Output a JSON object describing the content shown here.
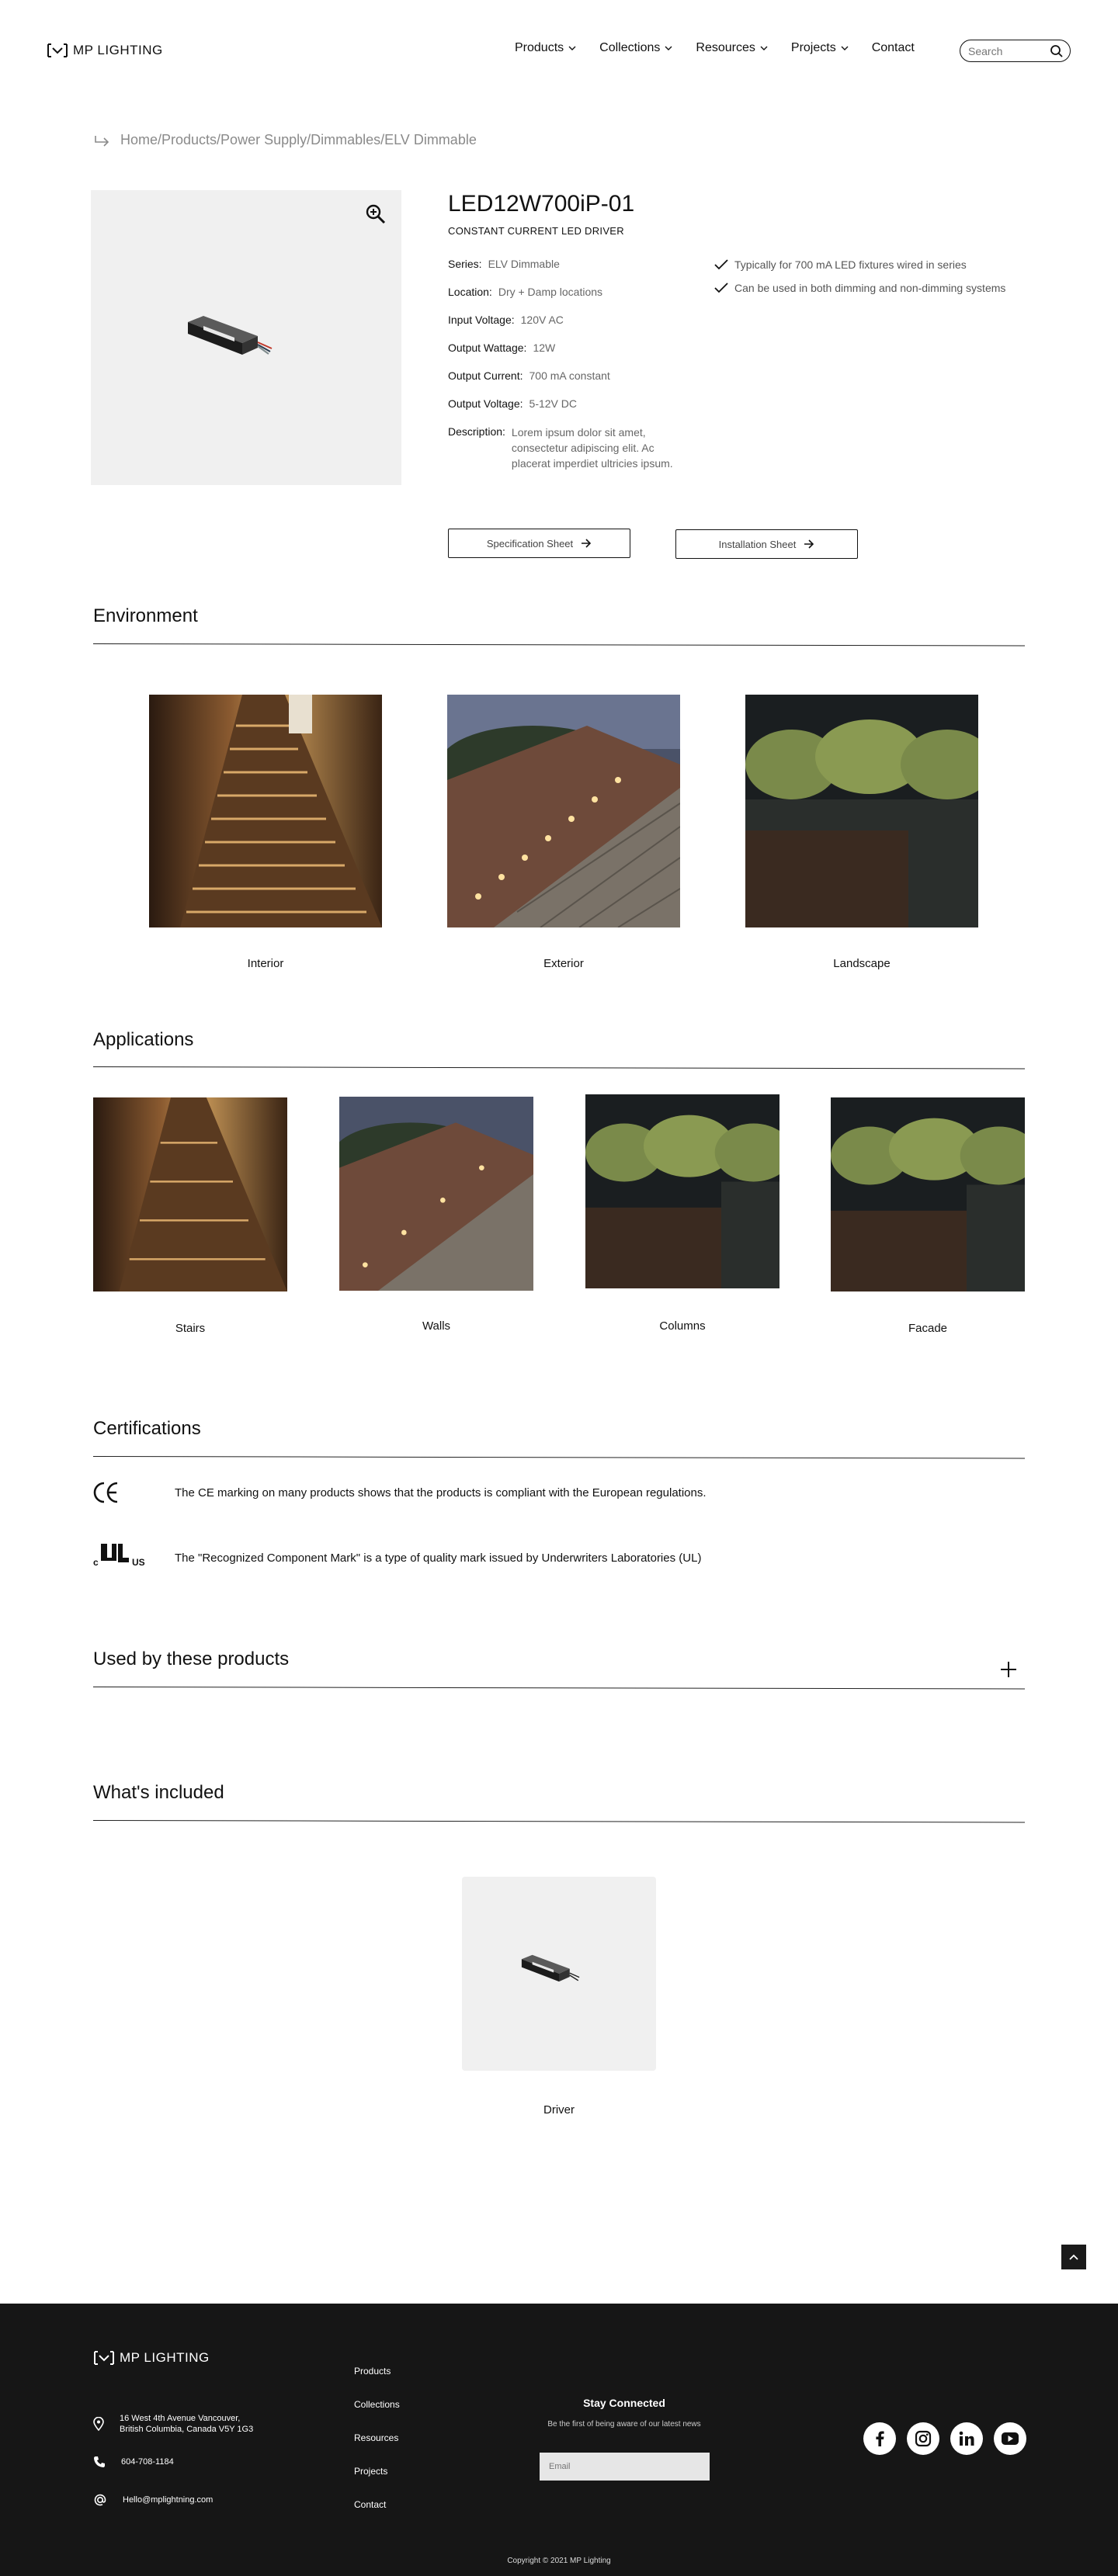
{
  "header": {
    "logo_text": "MP LIGHTING",
    "nav": [
      {
        "label": "Products",
        "dropdown": true
      },
      {
        "label": "Collections",
        "dropdown": true
      },
      {
        "label": "Resources",
        "dropdown": true
      },
      {
        "label": "Projects",
        "dropdown": true
      },
      {
        "label": "Contact",
        "dropdown": false
      }
    ],
    "search_placeholder": "Search"
  },
  "breadcrumb": "Home/Products/Power Supply/Dimmables/ELV Dimmable",
  "product": {
    "title": "LED12W700iP-01",
    "subtitle": "CONSTANT CURRENT LED DRIVER",
    "specs": [
      {
        "key": "Series:",
        "value": "ELV Dimmable"
      },
      {
        "key": "Location:",
        "value": "Dry + Damp locations"
      },
      {
        "key": "Input Voltage:",
        "value": "120V AC"
      },
      {
        "key": "Output Wattage:",
        "value": "12W"
      },
      {
        "key": "Output Current:",
        "value": "700 mA constant"
      },
      {
        "key": "Output Voltage:",
        "value": "5-12V DC"
      },
      {
        "key": "Description:",
        "value": "Lorem ipsum dolor sit amet, consectetur adipiscing elit. Ac placerat imperdiet ultricies ipsum."
      }
    ],
    "features": [
      "Typically for 700 mA LED fixtures wired in series",
      "Can be used in both dimming and non-dimming systems"
    ],
    "buttons": {
      "spec_sheet": "Specification Sheet",
      "install_sheet": "Installation Sheet"
    }
  },
  "environment": {
    "title": "Environment",
    "items": [
      "Interior",
      "Exterior",
      "Landscape"
    ]
  },
  "applications": {
    "title": "Applications",
    "items": [
      "Stairs",
      "Walls",
      "Columns",
      "Facade"
    ]
  },
  "certifications": {
    "title": "Certifications",
    "items": [
      {
        "icon": "ce-mark-icon",
        "text": "The CE marking on many products shows that the products is compliant with the European regulations."
      },
      {
        "icon": "ul-recognized-icon",
        "text": "The \"Recognized Component Mark\" is a type of quality mark issued by Underwriters Laboratories (UL)"
      }
    ]
  },
  "used_by": {
    "title": "Used by these products"
  },
  "included": {
    "title": "What's included",
    "items": [
      "Driver"
    ]
  },
  "footer": {
    "logo_text": "MP LIGHTING",
    "address_line1": "16 West 4th Avenue Vancouver,",
    "address_line2": "British Columbia, Canada V5Y 1G3",
    "phone": "604-708-1184",
    "email": "Hello@mplightning.com",
    "links": [
      "Products",
      "Collections",
      "Resources",
      "Projects",
      "Contact"
    ],
    "stay_title": "Stay Connected",
    "stay_sub": "Be the first of being aware of our latest news",
    "email_placeholder": "Email",
    "socials": [
      "facebook-icon",
      "instagram-icon",
      "linkedin-icon",
      "youtube-icon"
    ],
    "copyright": "Copyright © 2021 MP Lighting"
  }
}
